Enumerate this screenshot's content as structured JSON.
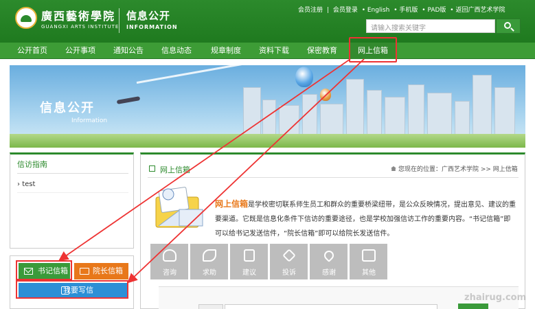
{
  "header": {
    "logo_cn": "廣西藝術學院",
    "logo_en": "GUANGXI ARTS INSTITUTE",
    "site_title": "信息公开",
    "site_sub": "INFORMATION",
    "toplinks": [
      "会员注册",
      "|",
      "会员登录",
      "• English",
      "• 手机版",
      "• PAD版",
      "• 返回广西艺术学院"
    ],
    "search_placeholder": "请输入搜索关键字"
  },
  "nav": {
    "items": [
      "公开首页",
      "公开事项",
      "通知公告",
      "信息动态",
      "规章制度",
      "资料下载",
      "保密教育",
      "网上信箱"
    ]
  },
  "banner": {
    "title": "信息公开",
    "subtitle": "Information"
  },
  "sidebar": {
    "title": "信访指南",
    "items": [
      "test"
    ],
    "btn_secretary": "书记信箱",
    "btn_president": "院长信箱",
    "btn_write": "我要写信"
  },
  "main": {
    "section_title": "网上信箱",
    "breadcrumb": "您现在的位置：广西艺术学院 >> 网上信箱",
    "intro_lead": "网上信箱",
    "intro_text": "是学校密切联系师生员工和群众的重要桥梁纽带，是公众反映情况，提出意见、建议的重要渠道。它既是信息化条件下信访的重要途径，也是学校加强信访工作的重要内容。“书记信箱”即可以给书记发送信件，“院长信箱”即可以给院长发送信件。",
    "tabs": [
      "咨询",
      "求助",
      "建议",
      "投诉",
      "感谢",
      "其他"
    ]
  },
  "watermark": "zhairug.com",
  "colors": {
    "header_green": "#2c8a2c",
    "nav_green": "#3d9c36",
    "accent_orange": "#e8781a",
    "button_blue": "#2c8fd6",
    "annotation_red": "#e33333"
  }
}
